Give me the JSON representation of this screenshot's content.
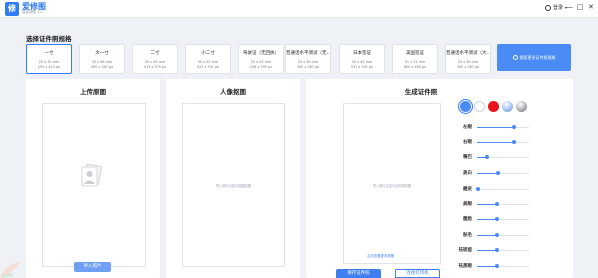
{
  "app": {
    "name": "爱修图",
    "version": "智能修图 1.0",
    "logo_glyph": "修"
  },
  "user": {
    "label": "登录"
  },
  "window_controls": {
    "minimize": "—",
    "restore": "□",
    "close": "✕"
  },
  "spec_section": {
    "title": "选择证件照规格"
  },
  "specs": [
    {
      "name": "一寸",
      "size_mm": "25 x 35 mm",
      "size_px": "295 x 413 px"
    },
    {
      "name": "大一寸",
      "size_mm": "33 x 48 mm",
      "size_px": "390 x 567 px"
    },
    {
      "name": "二寸",
      "size_mm": "35 x 49 mm",
      "size_px": "413 x 579 px"
    },
    {
      "name": "小二寸",
      "size_mm": "35 x 45 mm",
      "size_px": "413 x 531 px"
    },
    {
      "name": "驾驶证（无回执）",
      "size_mm": "20 x 25 mm",
      "size_px": "236 x 295 px"
    },
    {
      "name": "普通话水平测试（无…",
      "size_mm": "33 x 48 mm",
      "size_px": "390 x 567 px"
    },
    {
      "name": "日本签证",
      "size_mm": "45 x 45 mm",
      "size_px": "531 x 531 px"
    },
    {
      "name": "美国签证",
      "size_mm": "51 x 51 mm",
      "size_px": "600 x 600 px"
    },
    {
      "name": "普通话水平测试（大…",
      "size_mm": "33 x 48 mm",
      "size_px": "390 x 567 px"
    }
  ],
  "more_specs": {
    "label": "搜索更多证件照规格"
  },
  "upload_panel": {
    "title": "上传原图",
    "button": "导入照片"
  },
  "portrait_panel": {
    "title": "人像抠图",
    "placeholder": "导入照片后显示抠图结果"
  },
  "result_panel": {
    "title": "生成证件照",
    "placeholder": "导入照片后显示证件照效果",
    "tip_link": "点击查看更多规格",
    "save_button": "保存证件照",
    "print_button": "连接打印机"
  },
  "background_colors": [
    {
      "name": "blue",
      "color": "#4a8bf5",
      "selected": true
    },
    {
      "name": "white",
      "color": "#ffffff",
      "selected": false
    },
    {
      "name": "red",
      "color": "#e8141b",
      "selected": false
    },
    {
      "name": "blue-gradient",
      "color": "#7fa9f0",
      "selected": false
    },
    {
      "name": "gray-gradient",
      "color": "#8a8f99",
      "selected": false
    }
  ],
  "adjustments": [
    {
      "label": "左眼",
      "value": 0.72
    },
    {
      "label": "右眼",
      "value": 0.72
    },
    {
      "label": "嘴巴",
      "value": 0.2
    },
    {
      "label": "美白",
      "value": 0.4
    },
    {
      "label": "磨皮",
      "value": 0.02
    },
    {
      "label": "美眼",
      "value": 0.38
    },
    {
      "label": "瘦脸",
      "value": 0.38
    },
    {
      "label": "肤毛",
      "value": 0.38
    },
    {
      "label": "祛斑痘",
      "value": 0.38
    },
    {
      "label": "祛黑眼",
      "value": 0.38
    }
  ],
  "accent_color": "#2f7cf6"
}
